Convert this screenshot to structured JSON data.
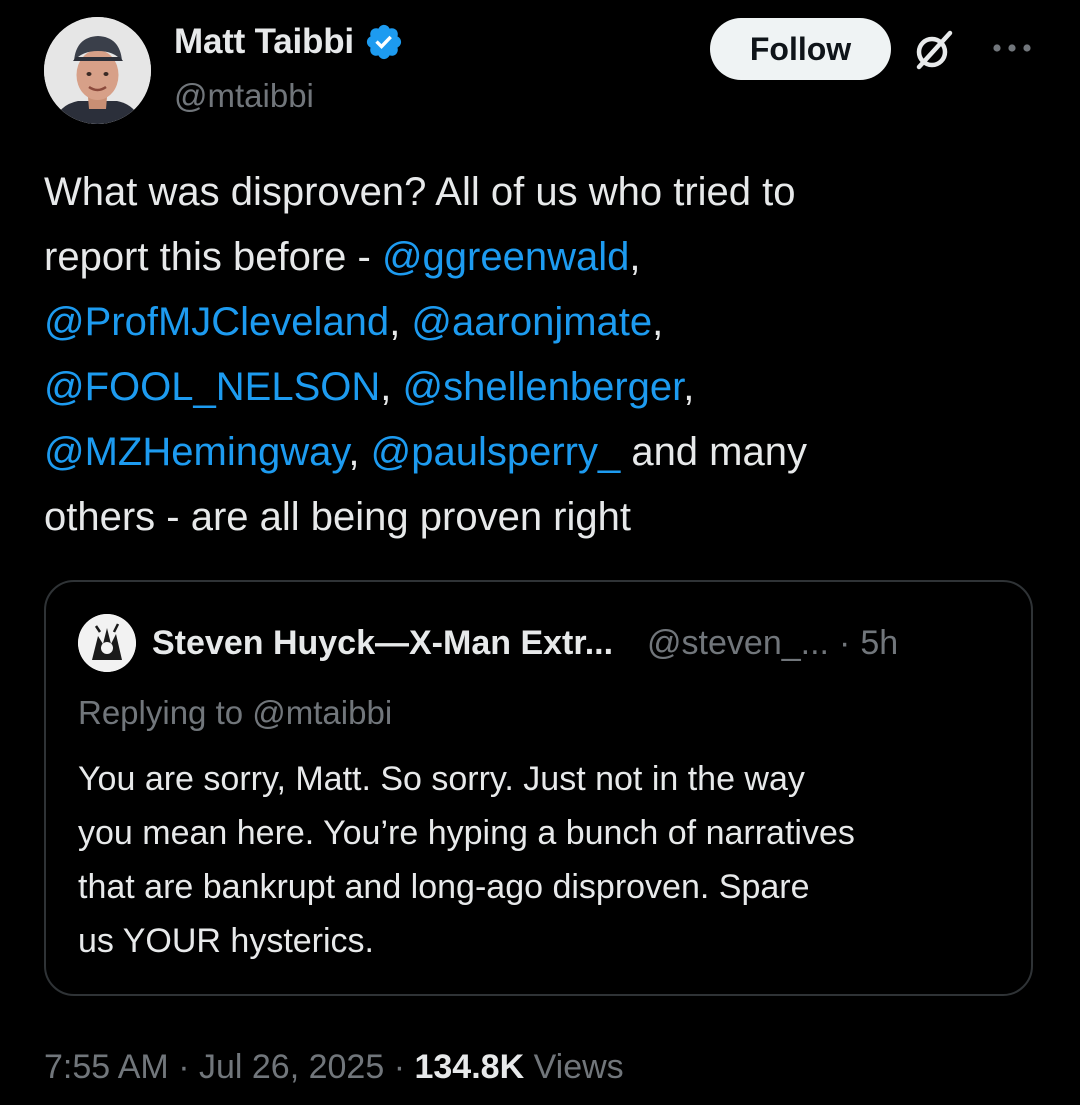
{
  "author": {
    "name": "Matt Taibbi",
    "handle": "@mtaibbi",
    "verified": true,
    "avatar_icon": "profile-photo"
  },
  "actions": {
    "follow_label": "Follow",
    "grok_icon": "grok-icon",
    "more_icon": "more-icon"
  },
  "tweet": {
    "lines": [
      [
        {
          "t": "What was disproven? All of us who tried to",
          "m": false
        }
      ],
      [
        {
          "t": "report this before - ",
          "m": false
        },
        {
          "t": "@ggreenwald",
          "m": true
        },
        {
          "t": ",",
          "m": false
        }
      ],
      [
        {
          "t": "@ProfMJCleveland",
          "m": true
        },
        {
          "t": ", ",
          "m": false
        },
        {
          "t": "@aaronjmate",
          "m": true
        },
        {
          "t": ",",
          "m": false
        }
      ],
      [
        {
          "t": "@FOOL_NELSON",
          "m": true
        },
        {
          "t": ", ",
          "m": false
        },
        {
          "t": "@shellenberger",
          "m": true
        },
        {
          "t": ",",
          "m": false
        }
      ],
      [
        {
          "t": "@MZHemingway",
          "m": true
        },
        {
          "t": ", ",
          "m": false
        },
        {
          "t": "@paulsperry_",
          "m": true
        },
        {
          "t": " and many",
          "m": false
        }
      ],
      [
        {
          "t": "others - are all being proven right",
          "m": false
        }
      ]
    ]
  },
  "quote": {
    "name": "Steven Huyck—X-Man Extr...",
    "handle": "@steven_...",
    "separator": "·",
    "time": "5h",
    "replying_to": "Replying to @mtaibbi",
    "lines": [
      "You are sorry, Matt. So sorry. Just not in the way",
      "you mean here. You’re hyping a bunch of narratives",
      "that are bankrupt and long-ago disproven. Spare",
      "us YOUR hysterics."
    ]
  },
  "meta": {
    "time": "7:55 AM",
    "separator": "·",
    "date": "Jul 26, 2025",
    "views_count": "134.8K",
    "views_label": "Views"
  },
  "colors": {
    "background": "#000000",
    "text": "#e7e9ea",
    "secondary": "#71767b",
    "link": "#1d9bf0",
    "border": "#2f3336",
    "verified": "#1d9bf0",
    "follow_bg": "#eff3f4"
  }
}
